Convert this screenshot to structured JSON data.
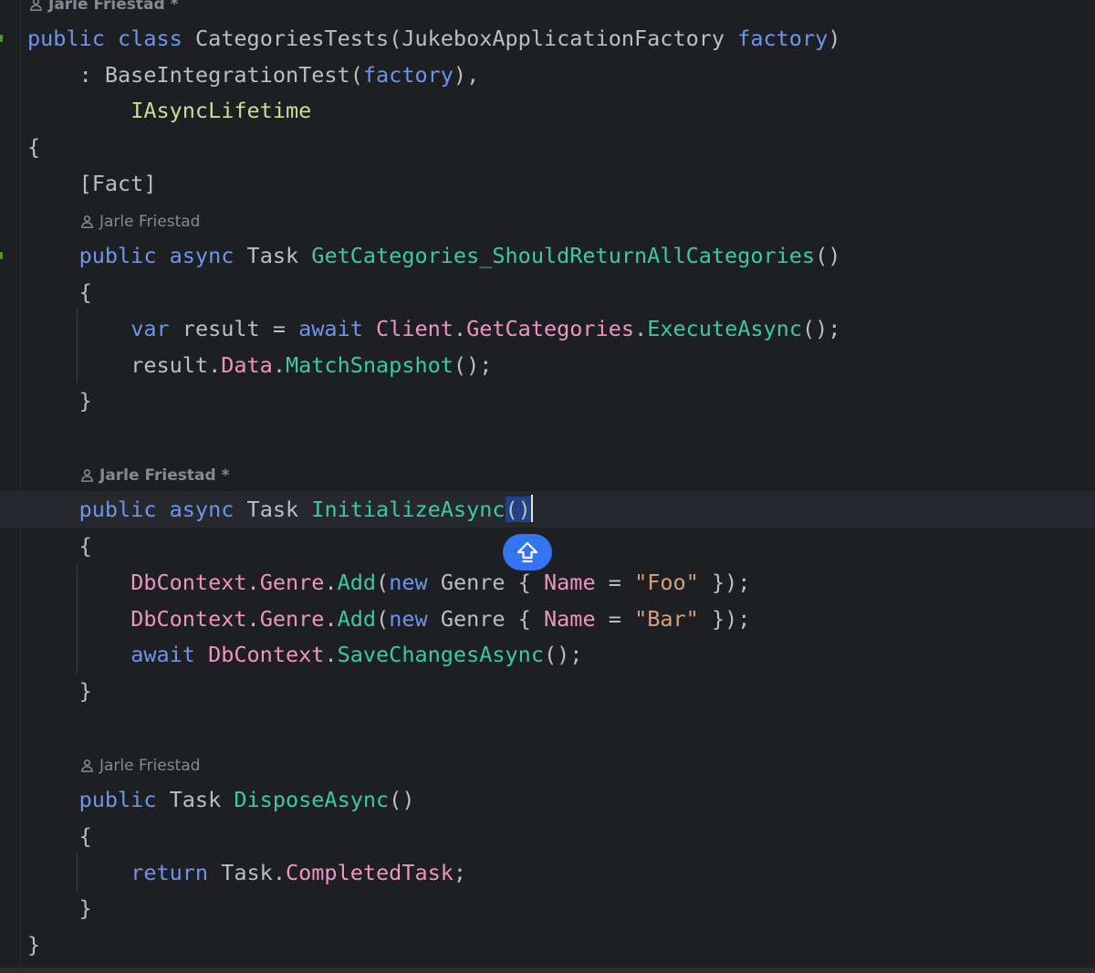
{
  "author_hints": {
    "top": "Jarle Friestad",
    "top_modified": "*",
    "get_categories": "Jarle Friestad",
    "initialize": "Jarle Friestad",
    "initialize_modified": "*",
    "dispose": "Jarle Friestad"
  },
  "code": {
    "l1": {
      "kw1": "public",
      "kw2": "class",
      "name": "CategoriesTests",
      "open": "(",
      "ptype": "JukeboxApplicationFactory",
      "param": "factory",
      "close": ")"
    },
    "l2": {
      "colon": ": ",
      "base": "BaseIntegrationTest",
      "open": "(",
      "arg": "factory",
      "close": "),"
    },
    "l3": {
      "iface": "IAsyncLifetime"
    },
    "l4": {
      "brace": "{"
    },
    "l5": {
      "attr": "[Fact]"
    },
    "l6": {
      "kw1": "public",
      "kw2": "async",
      "ret": "Task",
      "name": "GetCategories_ShouldReturnAllCategories",
      "parens": "()"
    },
    "l7": {
      "brace": "{"
    },
    "l8": {
      "kw": "var",
      "v": "result",
      "eq": " = ",
      "aw": "await",
      "obj": "Client",
      "dot1": ".",
      "prop": "GetCategories",
      "dot2": ".",
      "fn": "ExecuteAsync",
      "end": "();"
    },
    "l9": {
      "v": "result",
      "dot1": ".",
      "mem": "Data",
      "dot2": ".",
      "fn": "MatchSnapshot",
      "end": "();"
    },
    "l10": {
      "brace": "}"
    },
    "l11": {
      "kw1": "public",
      "kw2": "async",
      "ret": "Task",
      "name": "InitializeAsync",
      "sel": "()"
    },
    "l12": {
      "brace": "{"
    },
    "l13": {
      "obj": "DbContext",
      "dot1": ".",
      "mem": "Genre",
      "dot2": ".",
      "fn": "Add",
      "open": "(",
      "kw": "new",
      "ty": "Genre",
      "ob": " { ",
      "prop": "Name",
      "eq": " = ",
      "str": "\"Foo\"",
      "end": " });"
    },
    "l14": {
      "obj": "DbContext",
      "dot1": ".",
      "mem": "Genre",
      "dot2": ".",
      "fn": "Add",
      "open": "(",
      "kw": "new",
      "ty": "Genre",
      "ob": " { ",
      "prop": "Name",
      "eq": " = ",
      "str": "\"Bar\"",
      "end": " });"
    },
    "l15": {
      "aw": "await",
      "obj": "DbContext",
      "dot": ".",
      "fn": "SaveChangesAsync",
      "end": "();"
    },
    "l16": {
      "brace": "}"
    },
    "l17": {
      "kw": "public",
      "ret": "Task",
      "name": "DisposeAsync",
      "parens": "()"
    },
    "l18": {
      "brace": "{"
    },
    "l19": {
      "kw": "return",
      "obj": "Task",
      "dot": ".",
      "mem": "CompletedTask",
      "end": ";"
    },
    "l20": {
      "brace": "}"
    },
    "l21": {
      "brace": "}"
    }
  },
  "fab": {
    "icon": "move-up-icon"
  },
  "colors": {
    "background": "#1e1f22",
    "keyword": "#6c95eb",
    "method": "#39cc9b",
    "member": "#ed94c0",
    "string": "#d7a076",
    "interface": "#c9de96",
    "type_param": "#c191ff",
    "accent": "#3574f0"
  }
}
